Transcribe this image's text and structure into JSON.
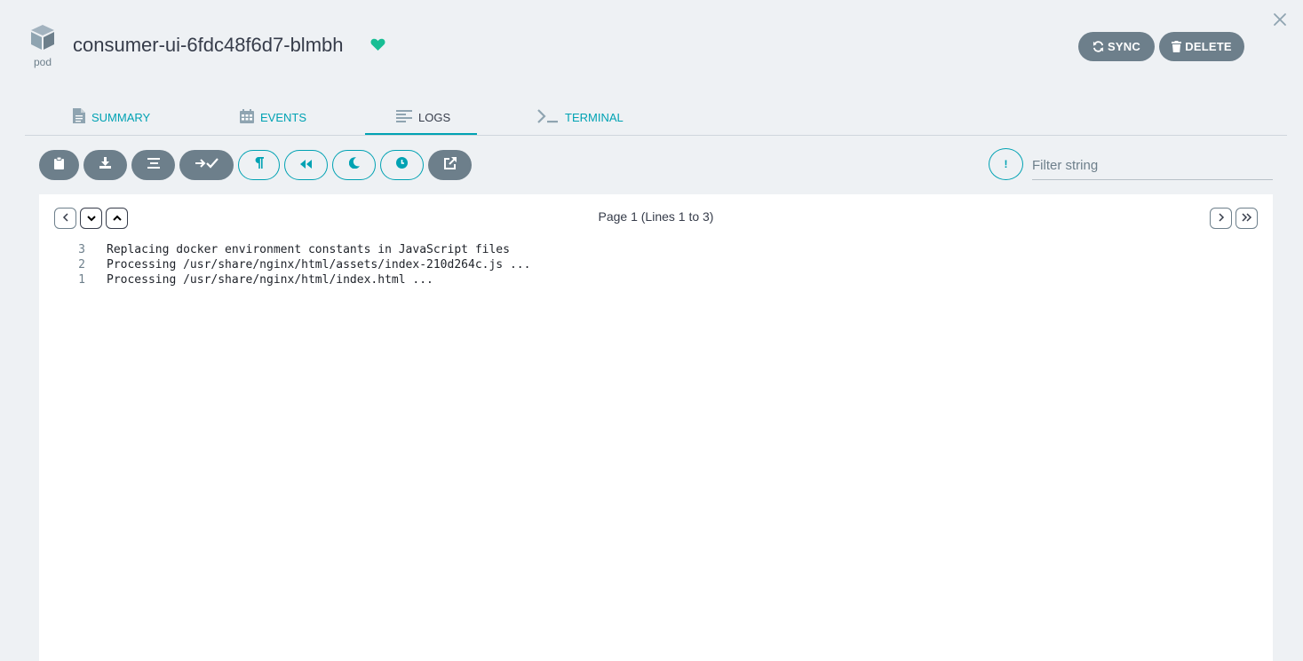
{
  "header": {
    "kind_label": "pod",
    "resource_name": "consumer-ui-6fdc48f6d7-blmbh",
    "health_status_icon": "heart-icon",
    "health_color": "#18be94",
    "sync_label": "SYNC",
    "delete_label": "DELETE"
  },
  "tabs": [
    {
      "label": "SUMMARY",
      "icon": "document-icon"
    },
    {
      "label": "EVENTS",
      "icon": "calendar-icon"
    },
    {
      "label": "LOGS",
      "icon": "align-left-icon",
      "active": true
    },
    {
      "label": "TERMINAL",
      "icon": "terminal-icon"
    }
  ],
  "toolbar": {
    "buttons": [
      {
        "name": "copy-logs",
        "icon": "clipboard-icon"
      },
      {
        "name": "download-logs",
        "icon": "download-icon"
      },
      {
        "name": "wrap-lines",
        "icon": "align-center-icon"
      },
      {
        "name": "follow-logs",
        "icon": "arrow-check-icon"
      },
      {
        "name": "show-previous",
        "icon": "paragraph-icon"
      },
      {
        "name": "since-start",
        "icon": "backward-icon"
      },
      {
        "name": "dark-mode",
        "icon": "moon-icon"
      },
      {
        "name": "show-timestamps",
        "icon": "clock-icon"
      },
      {
        "name": "open-in-new-window",
        "icon": "external-link-icon"
      }
    ],
    "filter_toggle_label": "!",
    "filter_placeholder": "Filter string",
    "filter_value": ""
  },
  "log_panel": {
    "page_info": "Page 1 (Lines 1 to 3)",
    "lines": [
      {
        "number": "3",
        "text": "Replacing docker environment constants in JavaScript files"
      },
      {
        "number": "2",
        "text": "Processing /usr/share/nginx/html/assets/index-210d264c.js ..."
      },
      {
        "number": "1",
        "text": "Processing /usr/share/nginx/html/index.html ..."
      }
    ]
  },
  "colors": {
    "accent": "#00a2b3",
    "button_gray": "#6d7f8b",
    "background": "#eef1f4",
    "text": "#363c4a"
  }
}
